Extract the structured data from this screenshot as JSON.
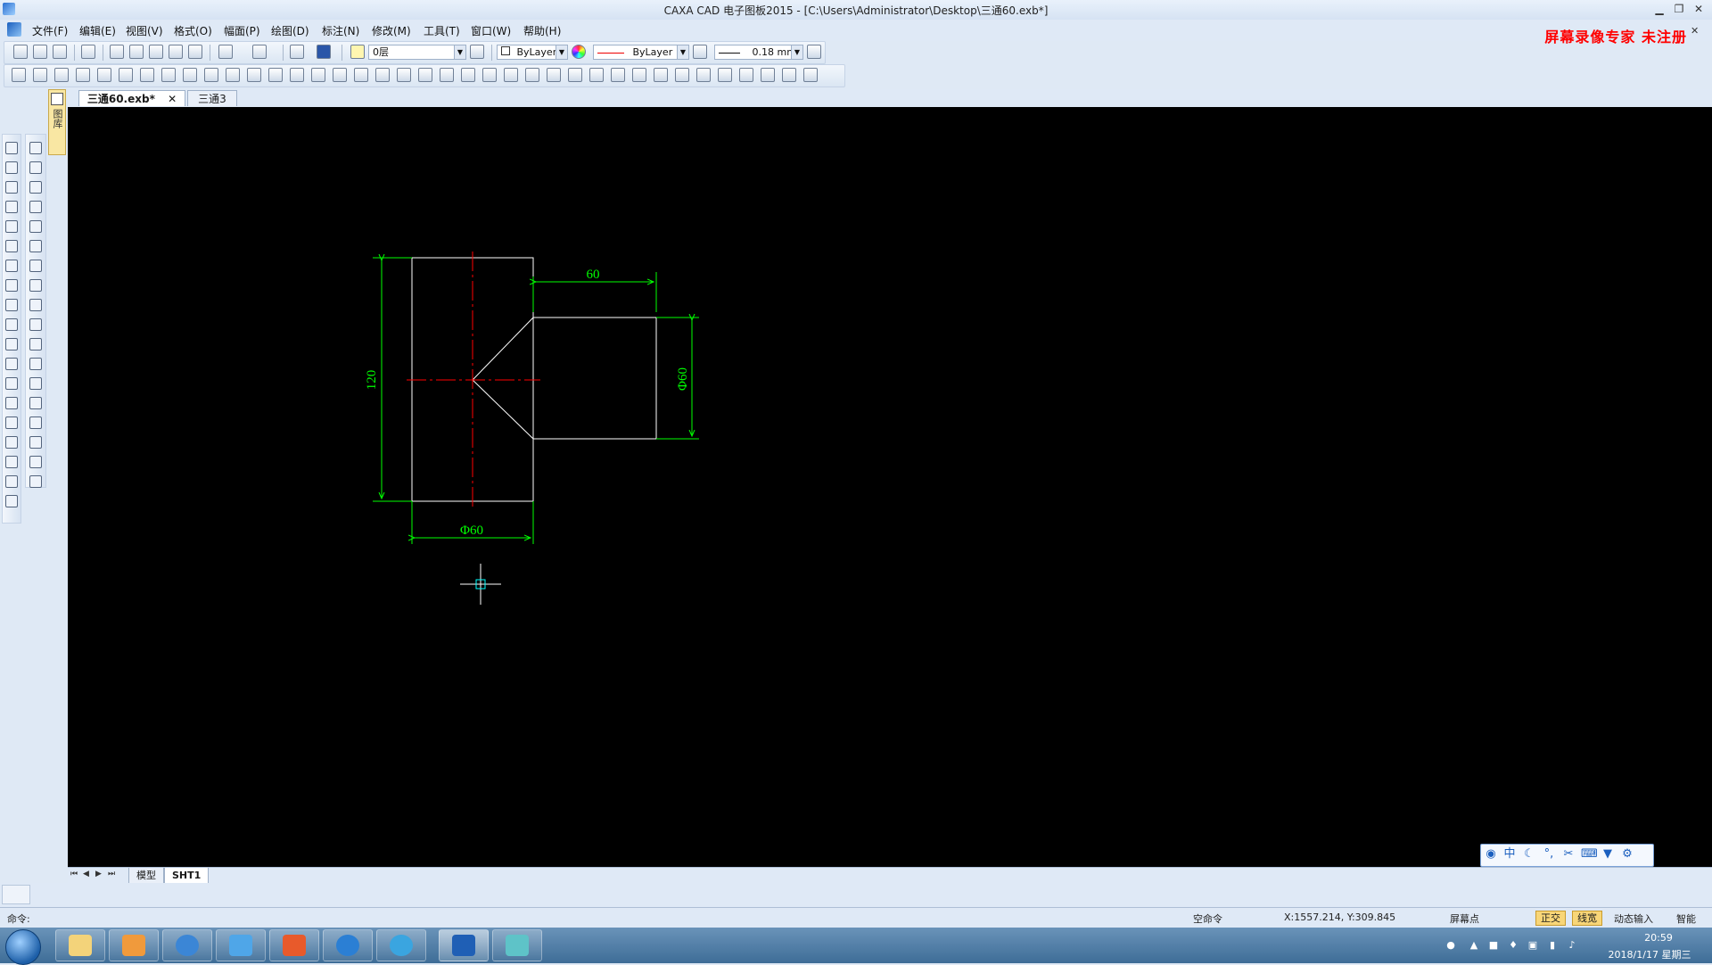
{
  "app": {
    "title": "CAXA CAD 电子图板2015 - [C:\\Users\\Administrator\\Desktop\\三通60.exb*]",
    "watermark": "屏幕录像专家  未注册"
  },
  "menu": {
    "items": [
      "文件(F)",
      "编辑(E)",
      "视图(V)",
      "格式(O)",
      "幅面(P)",
      "绘图(D)",
      "标注(N)",
      "修改(M)",
      "工具(T)",
      "窗口(W)",
      "帮助(H)"
    ]
  },
  "properties_toolbar": {
    "layer": "0层",
    "color": "ByLayer",
    "linetype": "ByLayer",
    "lineweight": "0.18 mm"
  },
  "document_tabs": [
    {
      "label": "三通60.exb*",
      "active": true
    },
    {
      "label": "三通3",
      "active": false
    }
  ],
  "side_tab": {
    "label": "图库"
  },
  "drawing": {
    "dimensions": {
      "height": "120",
      "branch_length": "60",
      "branch_diameter": "Φ60",
      "main_diameter": "Φ60"
    },
    "colors": {
      "outline": "#ffffff",
      "dimension": "#00ff00",
      "centerline": "#ff0000",
      "cursor_box": "#00ffff"
    }
  },
  "sheet_tabs": [
    {
      "label": "模型",
      "active": false
    },
    {
      "label": "SHT1",
      "active": true
    }
  ],
  "command": {
    "prompt": "命令:"
  },
  "status": {
    "mode": "空命令",
    "coords": "X:1557.214, Y:309.845",
    "snap": "屏幕点",
    "ortho": "正交",
    "lineweight": "线宽",
    "dynamic_input": "动态输入",
    "smart": "智能"
  },
  "ime": {
    "lang": "中"
  },
  "taskbar": {
    "time": "20:59",
    "date": "2018/1/17 星期三"
  }
}
